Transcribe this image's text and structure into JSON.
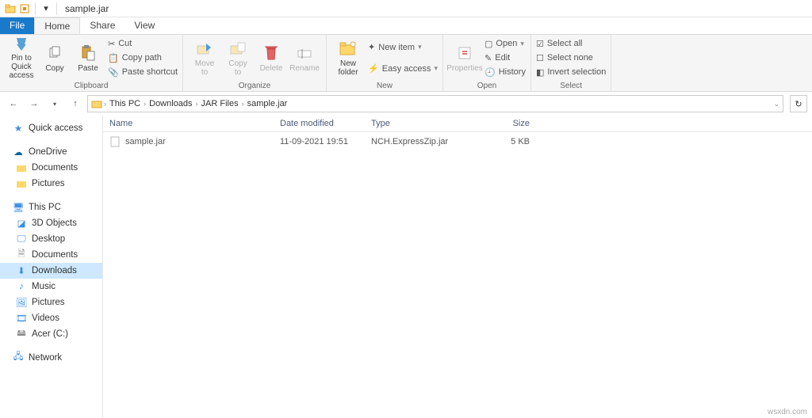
{
  "titlebar": {
    "title": "sample.jar"
  },
  "tabs": {
    "file": "File",
    "home": "Home",
    "share": "Share",
    "view": "View"
  },
  "ribbon": {
    "pin_line1": "Pin to Quick",
    "pin_line2": "access",
    "copy": "Copy",
    "paste": "Paste",
    "cut": "Cut",
    "copy_path": "Copy path",
    "paste_shortcut": "Paste shortcut",
    "clipboard": "Clipboard",
    "move_to": "Move",
    "move_to2": "to",
    "copy_to": "Copy",
    "copy_to2": "to",
    "delete": "Delete",
    "rename": "Rename",
    "organize": "Organize",
    "new_folder1": "New",
    "new_folder2": "folder",
    "new_item": "New item",
    "easy_access": "Easy access",
    "new": "New",
    "properties": "Properties",
    "open_btn": "Open",
    "edit": "Edit",
    "history": "History",
    "open": "Open",
    "select_all": "Select all",
    "select_none": "Select none",
    "invert": "Invert selection",
    "select": "Select"
  },
  "breadcrumb": {
    "p0": "This PC",
    "p1": "Downloads",
    "p2": "JAR Files",
    "p3": "sample.jar"
  },
  "nav": {
    "quick": "Quick access",
    "onedrive": "OneDrive",
    "documents": "Documents",
    "pictures": "Pictures",
    "thispc": "This PC",
    "objects3d": "3D Objects",
    "desktop": "Desktop",
    "documents2": "Documents",
    "downloads": "Downloads",
    "music": "Music",
    "pictures2": "Pictures",
    "videos": "Videos",
    "acer": "Acer (C:)",
    "network": "Network"
  },
  "columns": {
    "name": "Name",
    "date": "Date modified",
    "type": "Type",
    "size": "Size"
  },
  "files": {
    "r0": {
      "name": "sample.jar",
      "date": "11-09-2021 19:51",
      "type": "NCH.ExpressZip.jar",
      "size": "5 KB"
    }
  },
  "watermark": "wsxdn.com"
}
